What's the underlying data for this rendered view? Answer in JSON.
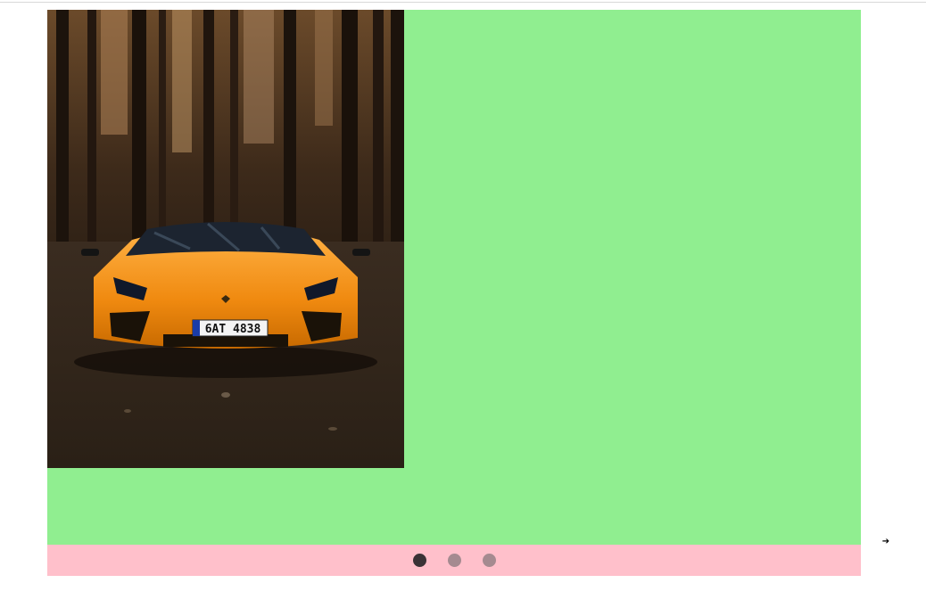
{
  "carousel": {
    "slides": [
      {
        "image": {
          "alt": "",
          "subject": "orange-sports-car-in-forest",
          "plate_text": "6AT 4838"
        },
        "background": "#90ee90"
      }
    ],
    "dots": [
      {
        "state": "active"
      },
      {
        "state": "inactive"
      },
      {
        "state": "inactive"
      }
    ],
    "active_index": 0,
    "next_icon": "arrow-right-icon",
    "next_glyph": "➔",
    "dots_bar_color": "#ffc0cb"
  }
}
